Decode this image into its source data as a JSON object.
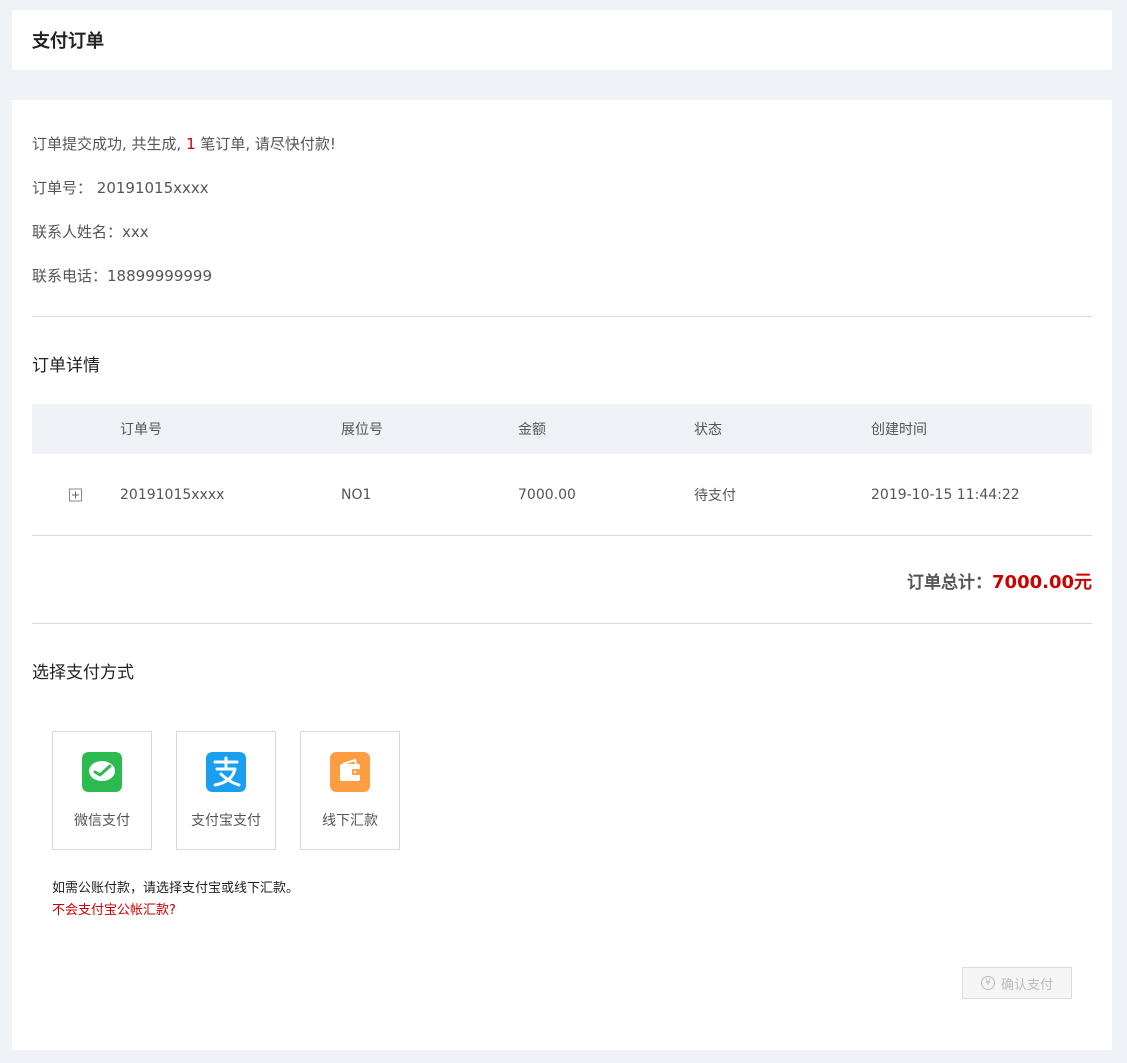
{
  "header": {
    "title": "支付订单"
  },
  "summary": {
    "msg_prefix": "订单提交成功, 共生成, ",
    "order_count": "1",
    "msg_suffix": " 笔订单, 请尽快付款!",
    "order_no_label": "订单号：",
    "order_no": "20191015xxxx",
    "contact_name_label": "联系人姓名：",
    "contact_name": "xxx",
    "phone_label": "联系电话：",
    "phone": "18899999999"
  },
  "details": {
    "title": "订单详情",
    "columns": [
      "订单号",
      "展位号",
      "金额",
      "状态",
      "创建时间"
    ],
    "rows": [
      {
        "order_no": "20191015xxxx",
        "booth": "NO1",
        "amount": "7000.00",
        "status": "待支付",
        "created": "2019-10-15 11:44:22"
      }
    ],
    "total_label": "订单总计：",
    "total_amount": "7000.00元"
  },
  "payment": {
    "title": "选择支付方式",
    "methods": [
      {
        "label": "微信支付",
        "icon": "wechat-pay-icon",
        "color": "#2dbb4f"
      },
      {
        "label": "支付宝支付",
        "icon": "alipay-icon",
        "color": "#1a9ff0"
      },
      {
        "label": "线下汇款",
        "icon": "wallet-icon",
        "color": "#ff9d42"
      }
    ],
    "note": "如需公账付款，请选择支付宝或线下汇款。",
    "help_link": "不会支付宝公帐汇款?",
    "confirm_label": "确认支付",
    "confirm_icon_glyph": "¥"
  },
  "colors": {
    "accent_red": "#cc0000",
    "background": "#eef1f5"
  }
}
